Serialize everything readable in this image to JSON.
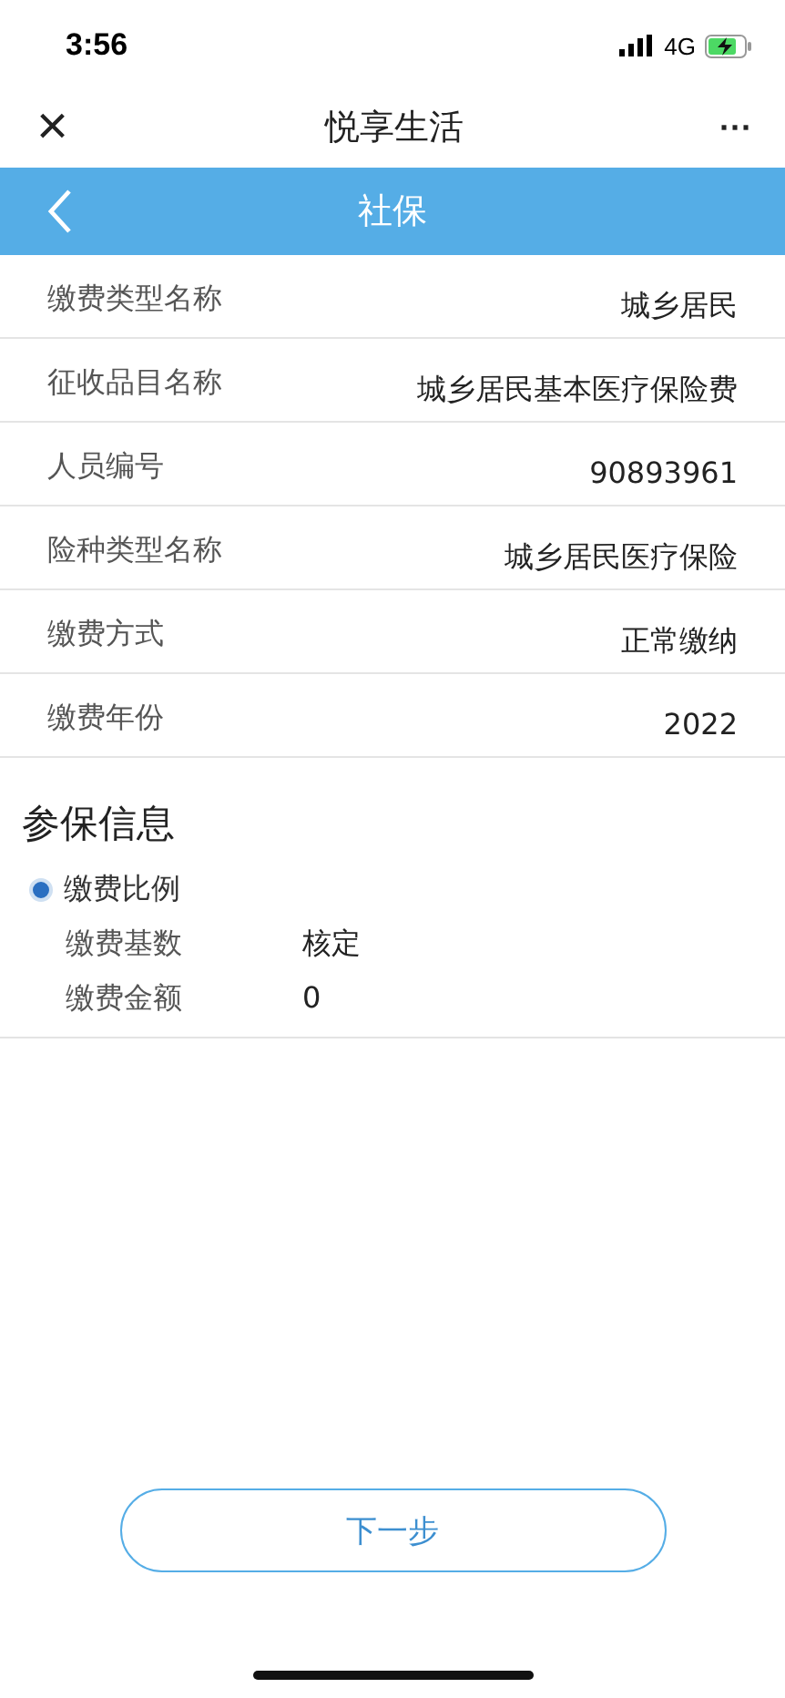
{
  "status_bar": {
    "time": "3:56",
    "network": "4G"
  },
  "nav_bar": {
    "close": "×",
    "title": "悦享生活",
    "more": "···"
  },
  "header": {
    "title": "社保"
  },
  "fields": [
    {
      "label": "缴费类型名称",
      "value": "城乡居民"
    },
    {
      "label": "征收品目名称",
      "value": "城乡居民基本医疗保险费"
    },
    {
      "label": "人员编号",
      "value": "90893961"
    },
    {
      "label": "险种类型名称",
      "value": "城乡居民医疗保险"
    },
    {
      "label": "缴费方式",
      "value": "正常缴纳"
    },
    {
      "label": "缴费年份",
      "value": "2022"
    }
  ],
  "section": {
    "title": "参保信息",
    "option": {
      "label": "缴费比例",
      "selected": true
    },
    "details": [
      {
        "label": "缴费基数",
        "value": "核定"
      },
      {
        "label": "缴费金额",
        "value": "0"
      }
    ]
  },
  "next_button": "下一步"
}
